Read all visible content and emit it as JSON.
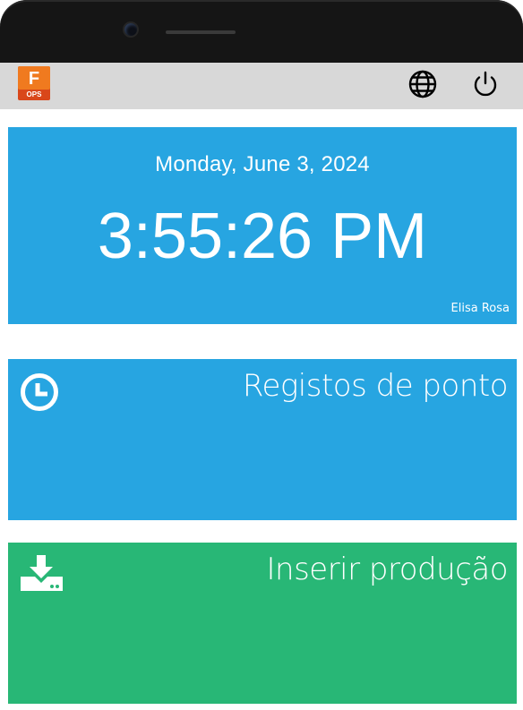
{
  "device": {
    "camera": "camera-icon"
  },
  "header": {
    "logo": {
      "letter": "F",
      "caption": "OPS",
      "icon": "app-logo-icon",
      "color": "#e8541b"
    },
    "language_icon": "globe-icon",
    "power_icon": "power-icon"
  },
  "clock": {
    "date": "Monday, June 3, 2024",
    "time": "3:55:26 PM",
    "user": "Elisa Rosa",
    "color": "#27a5e1"
  },
  "tiles": [
    {
      "label": "Registos de ponto",
      "icon": "clock-icon",
      "color": "#27a5e1"
    },
    {
      "label": "Inserir produção",
      "icon": "download-icon",
      "color": "#28b776"
    }
  ]
}
